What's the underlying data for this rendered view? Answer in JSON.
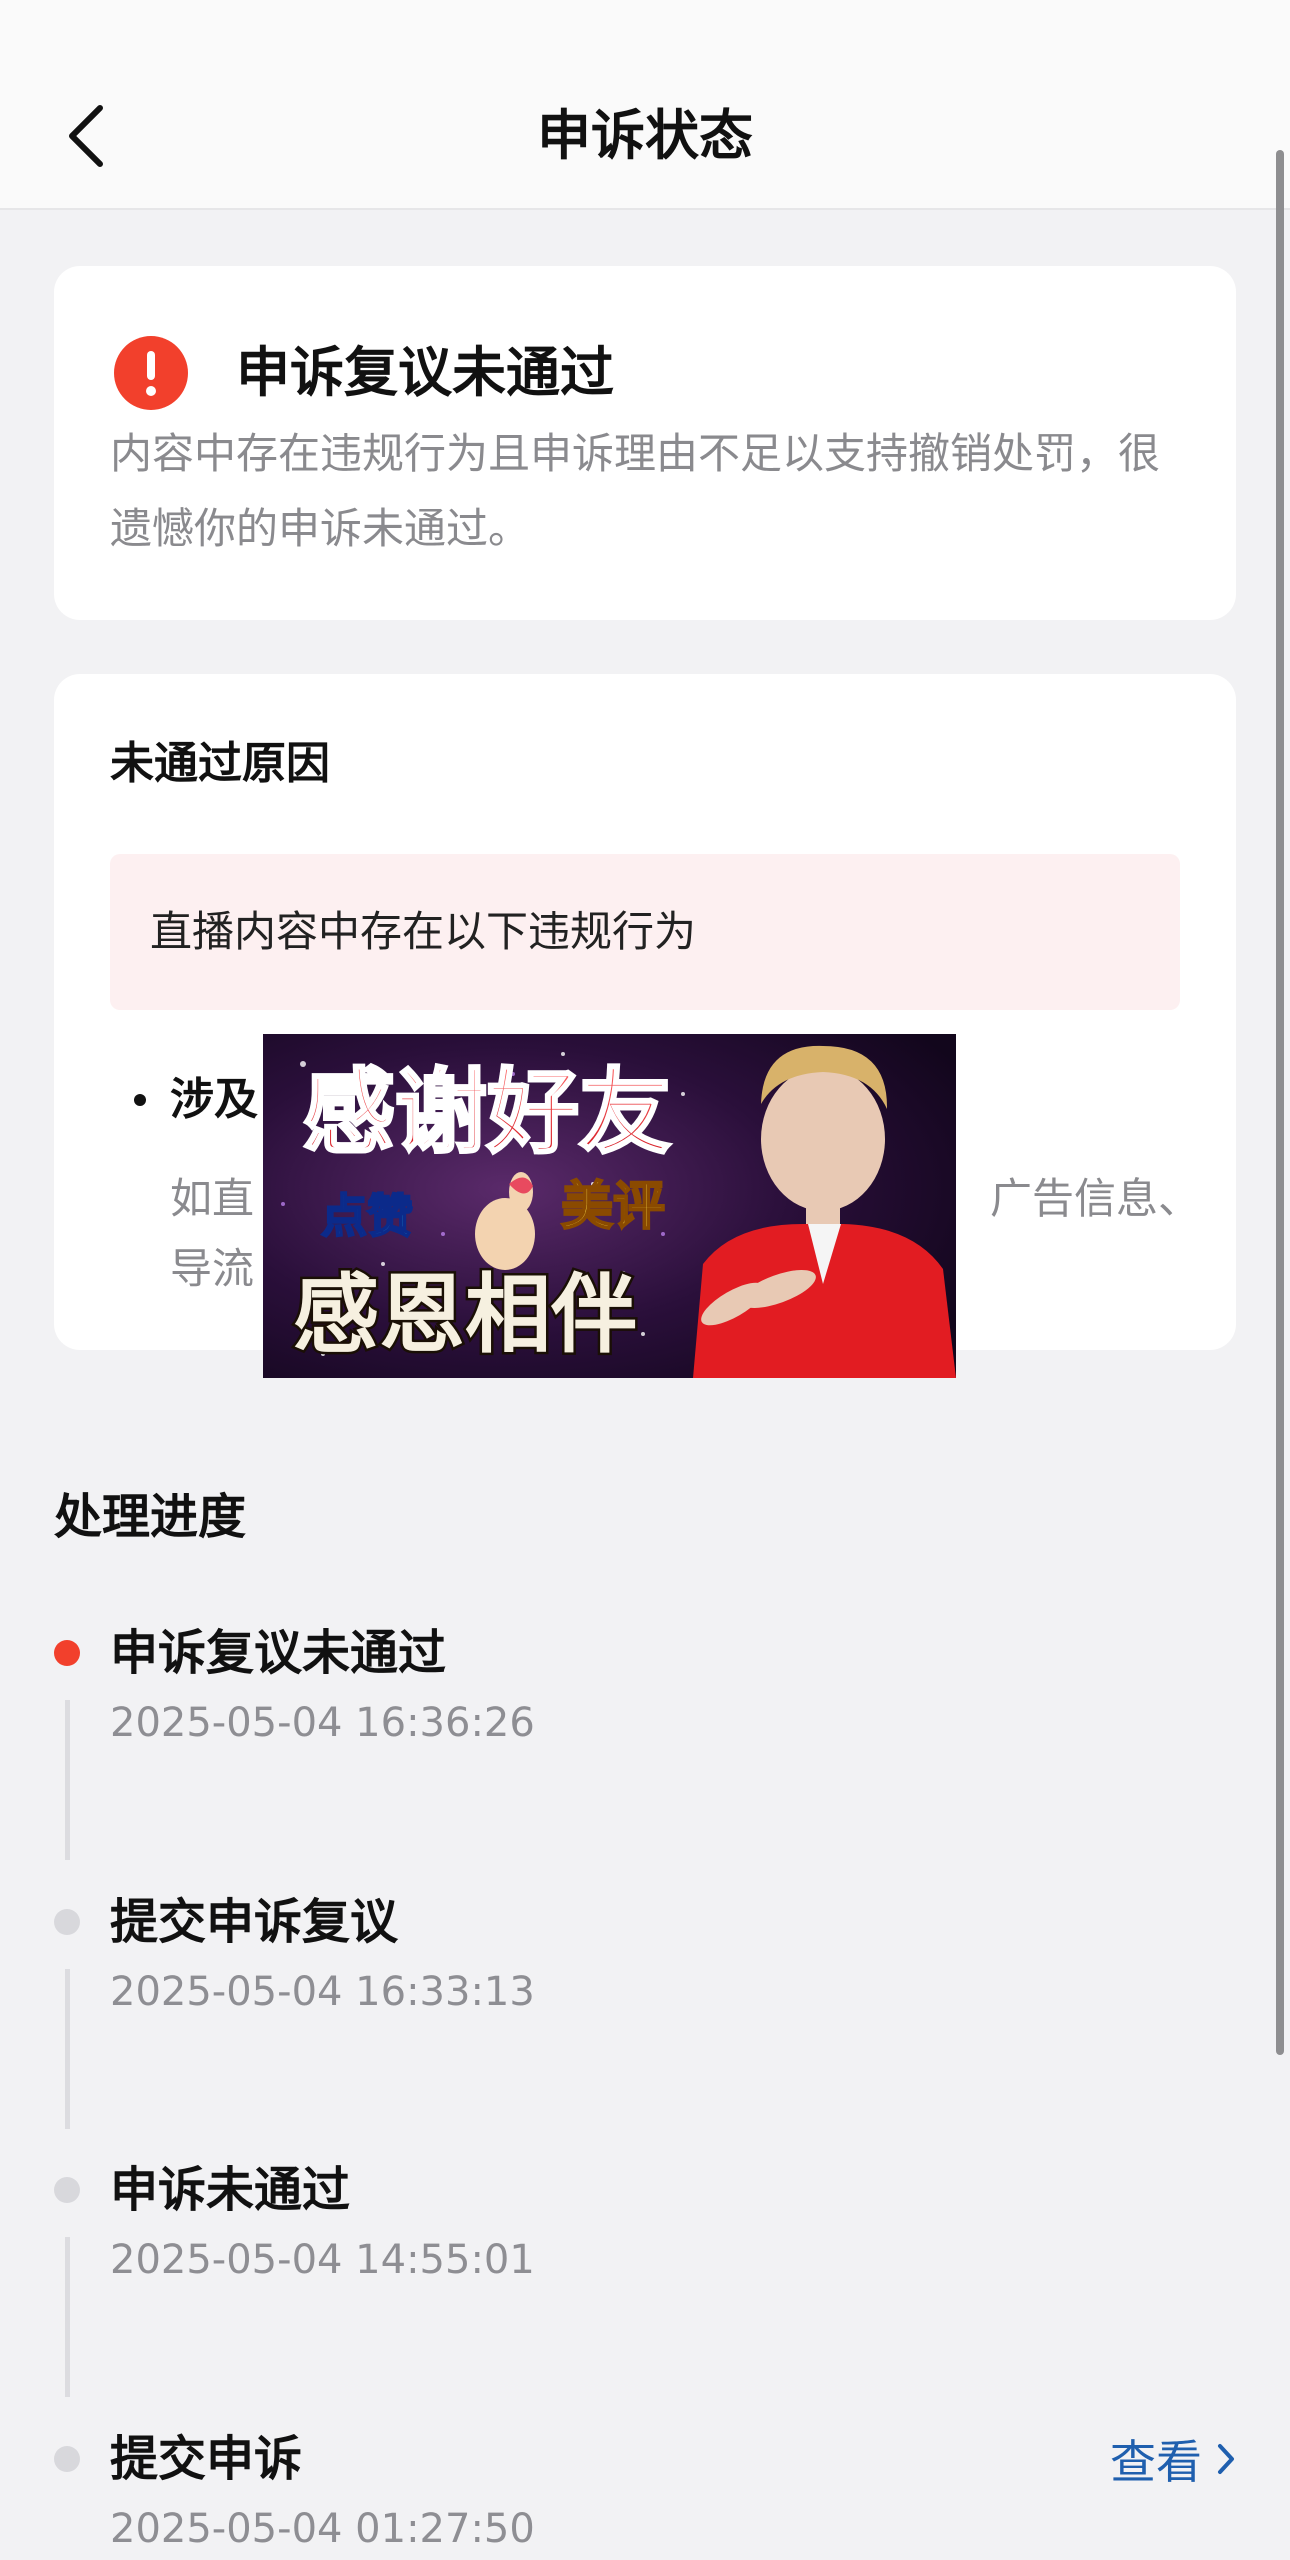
{
  "header": {
    "title": "申诉状态"
  },
  "status_card": {
    "title": "申诉复议未通过",
    "description": "内容中存在违规行为且申诉理由不足以支持撤销处罚，很遗憾你的申诉未通过。"
  },
  "reason_card": {
    "heading": "未通过原因",
    "box_text": "直播内容中存在以下违规行为",
    "bullet_title": "涉及",
    "bullet_desc_start": "如直",
    "bullet_desc_end": "广告信息、",
    "bullet_desc_line2": "导流"
  },
  "overlay_image": {
    "title": "感谢好友",
    "left_tag": "点赞",
    "right_tag": "美评",
    "bottom": "感恩相伴"
  },
  "progress": {
    "heading": "处理进度",
    "items": [
      {
        "title": "申诉复议未通过",
        "time": "2025-05-04 16:36:26"
      },
      {
        "title": "提交申诉复议",
        "time": "2025-05-04 16:33:13"
      },
      {
        "title": "申诉未通过",
        "time": "2025-05-04 14:55:01"
      },
      {
        "title": "提交申诉",
        "time": "2025-05-04 01:27:50",
        "action": "查看"
      }
    ]
  },
  "colors": {
    "alert_red": "#f2402c",
    "link_blue": "#1f5fae",
    "reason_bg": "#fdf0f1"
  }
}
